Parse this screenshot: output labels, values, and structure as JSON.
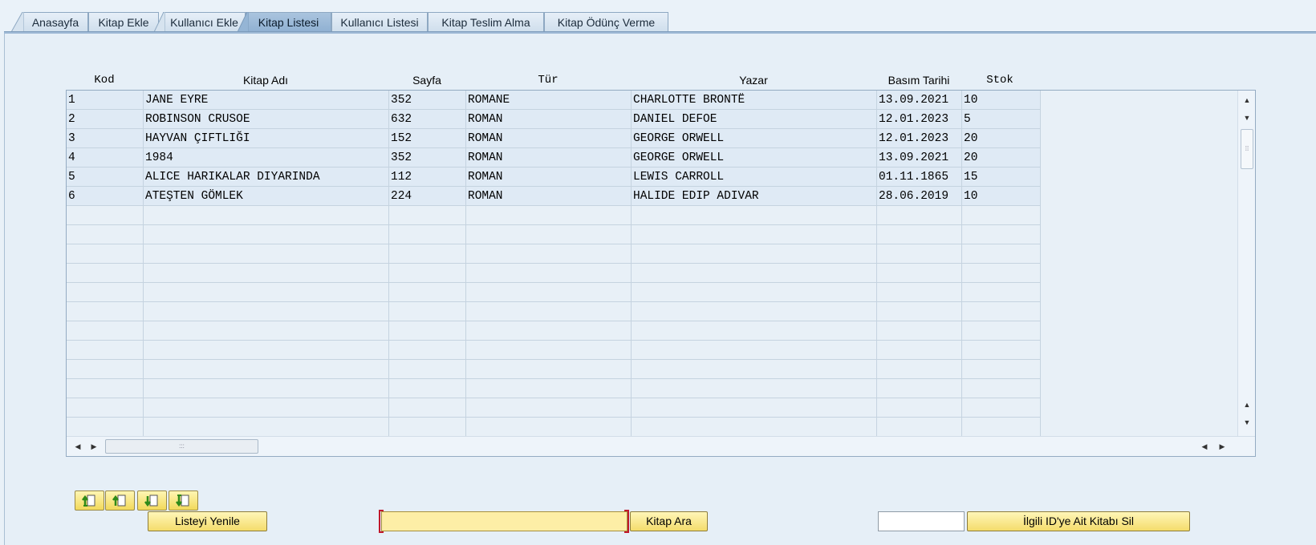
{
  "tabs": [
    {
      "label": "Anasayfa",
      "active": false
    },
    {
      "label": "Kitap Ekle",
      "active": false
    },
    {
      "label": "Kullanıcı Ekle",
      "active": false
    },
    {
      "label": "Kitap Listesi",
      "active": true
    },
    {
      "label": "Kullanıcı Listesi",
      "active": false
    },
    {
      "label": "Kitap Teslim Alma",
      "active": false
    },
    {
      "label": "Kitap Ödünç Verme",
      "active": false
    }
  ],
  "table": {
    "columns": [
      "Kod",
      "Kitap Adı",
      "Sayfa",
      "Tür",
      "Yazar",
      "Basım Tarihi",
      "Stok"
    ],
    "rows": [
      [
        "1",
        "JANE EYRE",
        "352",
        "ROMANE",
        "CHARLOTTE BRONTË",
        "13.09.2021",
        "10"
      ],
      [
        "2",
        "ROBINSON CRUSOE",
        "632",
        "ROMAN",
        "DANIEL DEFOE",
        "12.01.2023",
        "5"
      ],
      [
        "3",
        "HAYVAN ÇIFTLIĞI",
        "152",
        "ROMAN",
        "GEORGE ORWELL",
        "12.01.2023",
        "20"
      ],
      [
        "4",
        "1984",
        "352",
        "ROMAN",
        "GEORGE ORWELL",
        "13.09.2021",
        "20"
      ],
      [
        "5",
        "ALICE HARIKALAR DIYARINDA",
        "112",
        "ROMAN",
        "LEWIS CARROLL",
        "01.11.1865",
        "15"
      ],
      [
        "6",
        "ATEŞTEN GÖMLEK",
        "224",
        "ROMAN",
        "HALIDE EDIP ADIVAR",
        "28.06.2019",
        "10"
      ]
    ],
    "scrollbar": {
      "thumb_grip": "⁞⁞",
      "hthumb_grip": ":::"
    }
  },
  "controls": {
    "sort_buttons": [
      "sort-ascending-icon",
      "sort-up-icon",
      "sort-down-icon",
      "sort-descending-icon"
    ],
    "refresh_label": "Listeyi Yenile",
    "search_value": "",
    "search_label": "Kitap Ara",
    "delete_id_value": "",
    "delete_label": "İlgili ID'ye Ait Kitabı Sil"
  },
  "colors": {
    "active_tab": "#9fbcd9",
    "button_yellow": "#f4dc6c",
    "required_marker": "#c0182c"
  }
}
